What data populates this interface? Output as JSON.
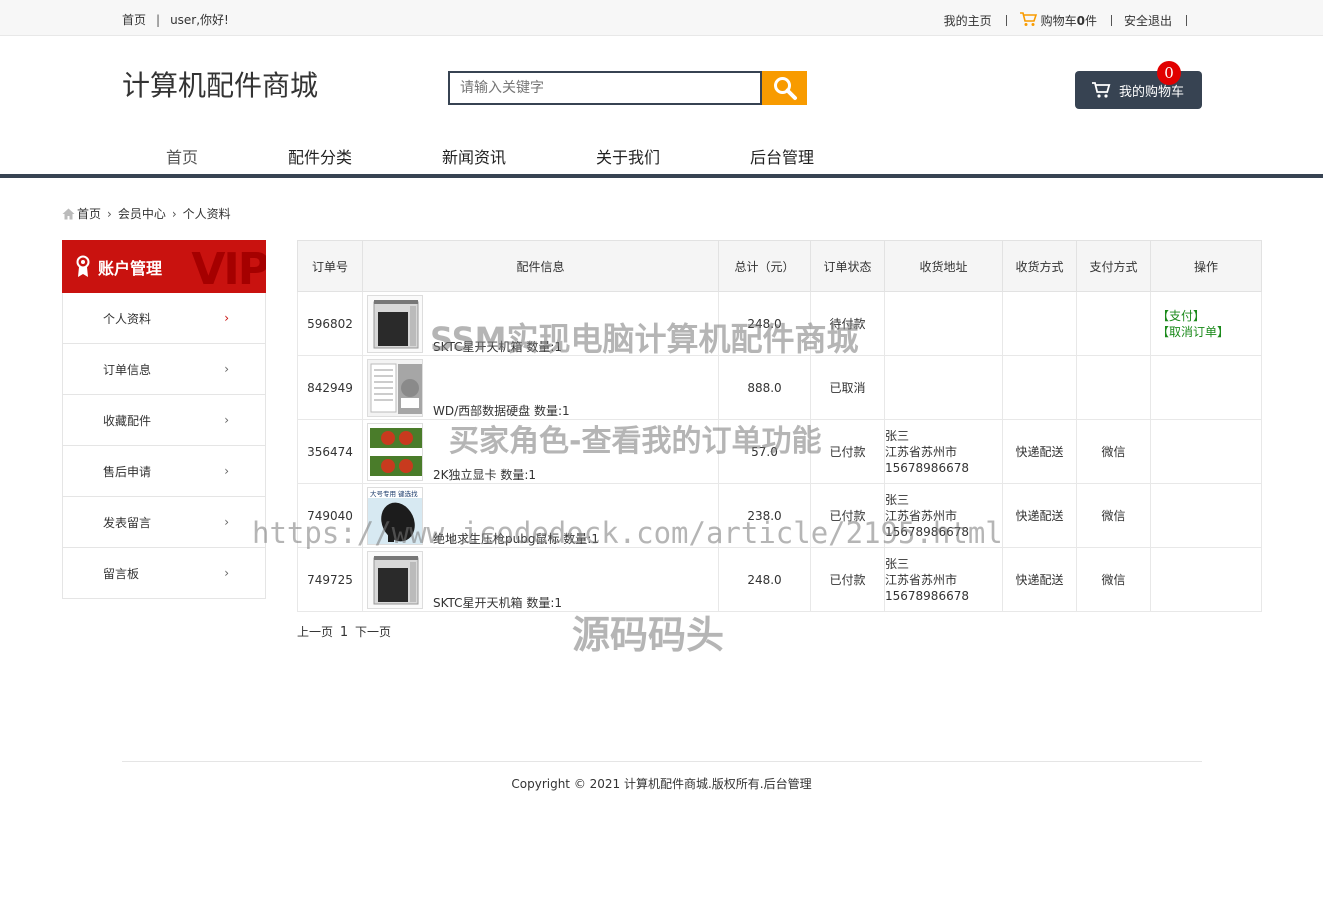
{
  "topbar": {
    "home": "首页",
    "greeting": "user,你好!",
    "my_home": "我的主页",
    "cart_prefix": "购物车",
    "cart_count": "0",
    "cart_suffix": "件",
    "logout": "安全退出"
  },
  "header": {
    "logo": "计算机配件商城",
    "search_placeholder": "请输入关键字",
    "cart_label": "我的购物车",
    "cart_badge": "0"
  },
  "nav": [
    "首页",
    "配件分类",
    "新闻资讯",
    "关于我们",
    "后台管理"
  ],
  "breadcrumb": [
    "首页",
    "会员中心",
    "个人资料"
  ],
  "sidebar": {
    "title": "账户管理",
    "vip": "VIP",
    "items": [
      "个人资料",
      "订单信息",
      "收藏配件",
      "售后申请",
      "发表留言",
      "留言板"
    ]
  },
  "table": {
    "headers": [
      "订单号",
      "配件信息",
      "总计（元）",
      "订单状态",
      "收货地址",
      "收货方式",
      "支付方式",
      "操作"
    ],
    "rows": [
      {
        "id": "596802",
        "product": "SKTC星开天机箱 数量:1",
        "total": "248.0",
        "status": "待付款",
        "addr_name": "",
        "addr_city": "",
        "addr_phone": "",
        "ship": "",
        "pay": "",
        "op1": "【支付】",
        "op2": "【取消订单】"
      },
      {
        "id": "842949",
        "product": "WD/西部数据硬盘 数量:1",
        "total": "888.0",
        "status": "已取消",
        "addr_name": "",
        "addr_city": "",
        "addr_phone": "",
        "ship": "",
        "pay": "",
        "op1": "",
        "op2": ""
      },
      {
        "id": "356474",
        "product": "2K独立显卡 数量:1",
        "total": "57.0",
        "status": "已付款",
        "addr_name": "张三",
        "addr_city": "江苏省苏州市",
        "addr_phone": "15678986678",
        "ship": "快递配送",
        "pay": "微信",
        "op1": "",
        "op2": ""
      },
      {
        "id": "749040",
        "product": "绝地求生压枪pubg鼠标 数量:1",
        "total": "238.0",
        "status": "已付款",
        "addr_name": "张三",
        "addr_city": "江苏省苏州市",
        "addr_phone": "15678986678",
        "ship": "快递配送",
        "pay": "微信",
        "op1": "",
        "op2": ""
      },
      {
        "id": "749725",
        "product": "SKTC星开天机箱 数量:1",
        "total": "248.0",
        "status": "已付款",
        "addr_name": "张三",
        "addr_city": "江苏省苏州市",
        "addr_phone": "15678986678",
        "ship": "快递配送",
        "pay": "微信",
        "op1": "",
        "op2": ""
      }
    ]
  },
  "pager": {
    "prev": "上一页",
    "page": "1",
    "next": "下一页"
  },
  "footer": "Copyright © 2021 计算机配件商城.版权所有.后台管理",
  "thumb_texts": {
    "mouse_banner": "大号专用 键选找"
  },
  "watermarks": [
    "SSM实现电脑计算机配件商城",
    "买家角色-查看我的订单功能",
    "https://www.icodedock.com/article/2195.html",
    "源码码头"
  ],
  "colors": {
    "accent": "#f89b00",
    "dark": "#374352",
    "red": "#c9120f",
    "green": "#1b8a1b"
  }
}
